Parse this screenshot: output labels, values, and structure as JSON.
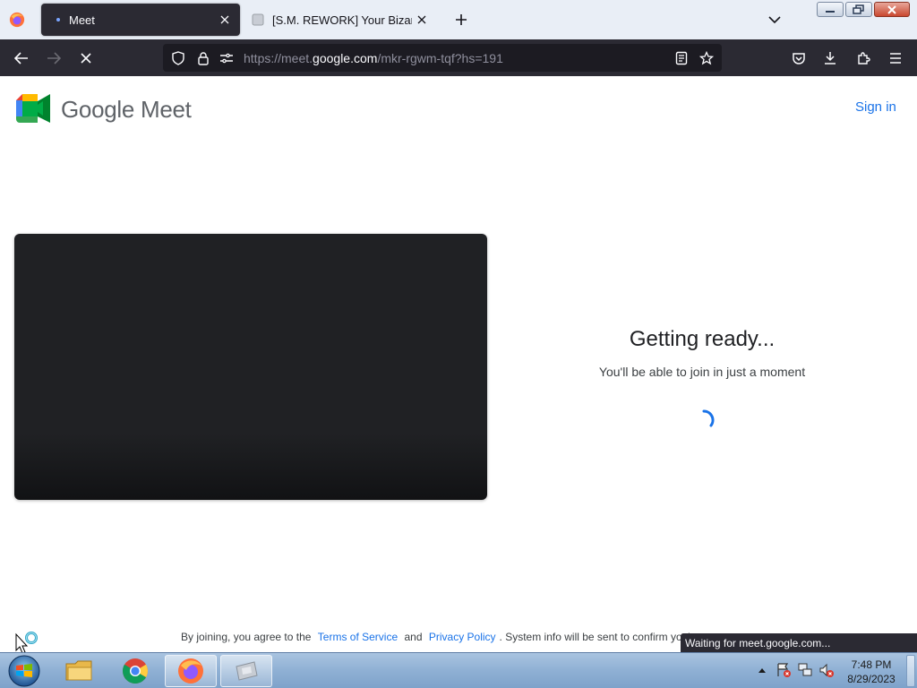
{
  "browser": {
    "tabs": [
      {
        "title": "Meet",
        "active": true
      },
      {
        "title": "[S.M. REWORK] Your Bizarre Ad",
        "active": false
      }
    ],
    "url": {
      "prefix": "https://meet.",
      "host": "google.com",
      "path": "/mkr-rgwm-tqf?hs=191"
    },
    "status_text": "Waiting for meet.google.com..."
  },
  "page": {
    "brand": "Google Meet",
    "sign_in": "Sign in",
    "ready_title": "Getting ready...",
    "ready_subtitle": "You'll be able to join in just a moment",
    "legal": {
      "prefix": "By joining, you agree to the",
      "terms": "Terms of Service",
      "and": "and",
      "privacy": "Privacy Policy",
      "suffix": ". System info will be sent to confirm you'"
    }
  },
  "taskbar": {
    "time": "7:48 PM",
    "date": "8/29/2023"
  },
  "colors": {
    "meet_blue": "#1a73e8",
    "toolbar_dark": "#2b2a33",
    "preview_bg": "#202124"
  }
}
